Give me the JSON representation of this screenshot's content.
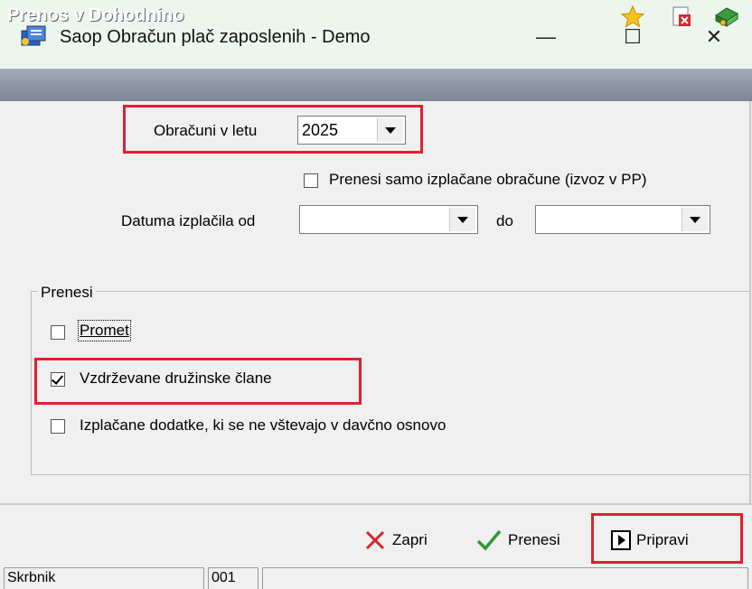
{
  "window": {
    "title": "Saop Obračun plač zaposlenih - Demo",
    "min_glyph": "—",
    "max_glyph": "☐",
    "close_glyph": "✕"
  },
  "panel": {
    "title": "Prenos v Dohodnino"
  },
  "form": {
    "year_label": "Obračuni v letu",
    "year_value": "2025",
    "only_paid_label": "Prenesi samo izplačane obračune (izvoz v PP)",
    "only_paid_checked": false,
    "date_from_label": "Datuma izplačila od",
    "date_from_value": "",
    "date_to_label": "do",
    "date_to_value": ""
  },
  "group": {
    "title": "Prenesi",
    "items": [
      {
        "label": "Promet",
        "checked": false
      },
      {
        "label": "Vzdrževane družinske člane",
        "checked": true
      },
      {
        "label": "Izplačane dodatke, ki se ne vštevajo v davčno osnovo",
        "checked": false
      }
    ]
  },
  "actions": {
    "close_label": "Zapri",
    "transfer_label": "Prenesi",
    "prepare_label": "Pripravi"
  },
  "status": {
    "user": "Skrbnik",
    "code": "001",
    "message": ""
  },
  "colors": {
    "highlight": "#e0202e",
    "panel_bar": "#8d98a4",
    "title_bar": "#edf6ed"
  }
}
